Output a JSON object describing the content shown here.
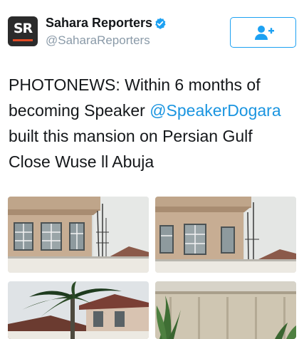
{
  "author": {
    "display_name": "Sahara Reporters",
    "handle": "@SaharaReporters",
    "avatar_text": "SR",
    "verified": true
  },
  "follow_button": {
    "icon": "add-user-icon"
  },
  "tweet": {
    "text_before": "PHOTONEWS: Within 6 months of becoming Speaker ",
    "mention": "@SpeakerDogara",
    "text_after": " built this mansion on Persian Gulf Close Wuse ll Abuja"
  },
  "media": {
    "count": 4,
    "items": [
      "photo-1",
      "photo-2",
      "photo-3",
      "photo-4"
    ]
  },
  "colors": {
    "accent": "#1da1f2",
    "mention": "#1b95e0",
    "handle": "#8a9aa8",
    "avatar_bg": "#2b2b2b",
    "avatar_bar": "#e04a24"
  }
}
